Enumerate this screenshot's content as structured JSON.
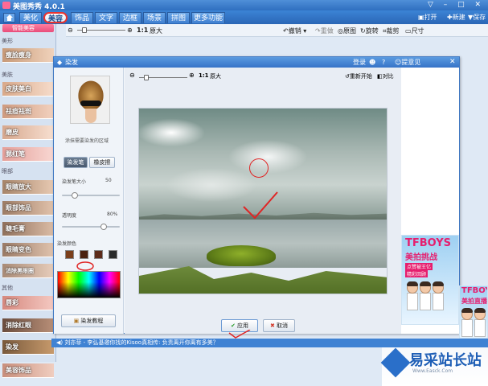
{
  "app": {
    "title": "美图秀秀 4.0.1",
    "window_controls": "▽ – □ ✕"
  },
  "menu": {
    "tabs": [
      {
        "label": "美化"
      },
      {
        "label": "美容"
      },
      {
        "label": "饰品"
      },
      {
        "label": "文字"
      },
      {
        "label": "边框"
      },
      {
        "label": "场景"
      },
      {
        "label": "拼图"
      },
      {
        "label": "更多功能 ▾"
      }
    ],
    "active_index": 1,
    "right": {
      "open": "打开",
      "new": "新建",
      "save": "保存"
    }
  },
  "toolbar": {
    "zoom_ratio": "1:1",
    "zoom_label": "原大",
    "undo": "撤销",
    "redo": "重做",
    "original": "原图",
    "rotate": "旋转",
    "crop": "裁剪",
    "size": "尺寸"
  },
  "sidebar": {
    "top_button": "智能美容",
    "sections": [
      {
        "title": "美形",
        "items": [
          "瘦脸瘦身"
        ]
      },
      {
        "title": "美肤",
        "items": [
          "皮肤美白",
          "祛痘祛斑",
          "磨皮",
          "腮红笔"
        ]
      },
      {
        "title": "眼部",
        "items": [
          "眼睛放大",
          "眼部饰品",
          "睫毛膏",
          "眼睛变色",
          "消除黑眼圈"
        ]
      },
      {
        "title": "其他",
        "items": [
          "唇彩",
          "消除红眼",
          "染发",
          "美容饰品"
        ]
      }
    ]
  },
  "dialog": {
    "title": "染发",
    "title_right": {
      "login": "登录",
      "help": "帮助",
      "feedback": "提意见"
    },
    "hint": "涂抹需要染发的区域",
    "mode_tabs": {
      "pen": "染发笔",
      "eraser": "橡皮擦"
    },
    "brush_size_label": "染发笔大小",
    "brush_size_value": "50",
    "opacity_label": "透明度",
    "opacity_value": "80%",
    "color_label": "染发颜色",
    "tutorial_button": "染发教程",
    "zoom_ratio": "1:1",
    "zoom_label": "原大",
    "restart": "重新开始",
    "compare": "对比",
    "apply_button": "应用",
    "cancel_button": "取消",
    "swatch_colors": [
      "#7a3e1a",
      "#4a2210",
      "#5c2b1a",
      "#2a2a2a"
    ]
  },
  "ads": {
    "ad1": {
      "title": "TFBOYS",
      "subtitle": "美拍挑战",
      "tag1": "点赞被王亿",
      "tag2": "精彩回顾"
    },
    "ad2": {
      "title": "TFBOYS",
      "subtitle": "美拍直播"
    }
  },
  "status": {
    "text": "刘亦菲 - 李弘基邀你找的Kisoo真相传: 负责离开你离有多美？"
  },
  "watermark": {
    "text": "易采站长站",
    "url": "Www.Easck.Com"
  }
}
